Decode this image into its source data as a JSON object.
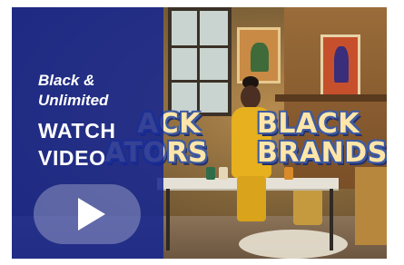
{
  "scene": {
    "headline_left": [
      "ACK",
      "ATORS"
    ],
    "headline_right": [
      "BLACK",
      "BRANDS"
    ]
  },
  "panel": {
    "subtitle_lines": [
      "Black &",
      "Unlimited"
    ],
    "cta_lines": [
      "WATCH",
      "VIDEO"
    ],
    "play_icon": "play-icon"
  },
  "colors": {
    "panel_blue": "#152791",
    "headline_fill": "#ffe6a8",
    "headline_outline": "#3f5aa0",
    "play_button_fill": "rgba(255,255,255,0.28)"
  }
}
